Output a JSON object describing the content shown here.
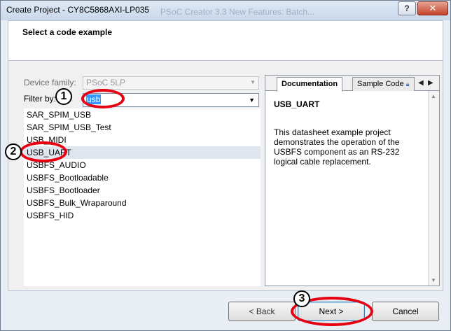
{
  "window": {
    "title": "Create Project - CY8C5868AXI-LP035",
    "background_title": "PSoC Creator 3.3 New Features: Batch...",
    "help_glyph": "?",
    "close_glyph": "✕"
  },
  "header": {
    "title": "Select a code example"
  },
  "form": {
    "device_family_label": "Device family:",
    "device_family_value": "PSoC 5LP",
    "filter_label": "Filter by:",
    "filter_value": "usb"
  },
  "examples": {
    "items": [
      "SAR_SPIM_USB",
      "SAR_SPIM_USB_Test",
      "USB_MIDI",
      "USB_UART",
      "USBFS_AUDIO",
      "USBFS_Bootloadable",
      "USBFS_Bootloader",
      "USBFS_Bulk_Wraparound",
      "USBFS_HID"
    ],
    "selected": "USB_UART"
  },
  "doc_panel": {
    "tabs": [
      "Documentation",
      "Sample Code"
    ],
    "active_tab": "Documentation",
    "title": "USB_UART",
    "text": "This datasheet example project demonstrates the operation of the USBFS component as an RS-232 logical cable replacement."
  },
  "buttons": {
    "back": "< Back",
    "next": "Next >",
    "cancel": "Cancel"
  },
  "annotations": {
    "step1": "1",
    "step2": "2",
    "step3": "3",
    "color": "#e60012"
  }
}
